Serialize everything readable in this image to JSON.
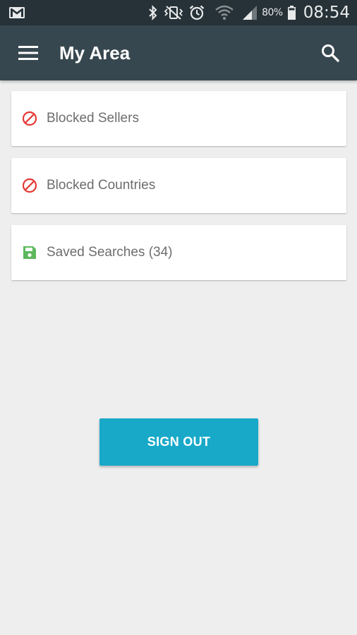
{
  "status_bar": {
    "icons": [
      "gmail-icon",
      "bluetooth-icon",
      "vibrate-icon",
      "alarm-icon",
      "wifi-icon",
      "signal-icon",
      "battery-icon"
    ],
    "battery": "80%",
    "time": "08:54"
  },
  "app_bar": {
    "title": "My Area",
    "menu_icon": "hamburger-menu-icon",
    "search_icon": "search-icon",
    "background": "#37474f"
  },
  "items": [
    {
      "label": "Blocked Sellers",
      "icon": "block-icon",
      "icon_color": "#e53935"
    },
    {
      "label": "Blocked Countries",
      "icon": "block-icon",
      "icon_color": "#e53935"
    },
    {
      "label": "Saved Searches (34)",
      "icon": "save-icon",
      "icon_color": "#5cb85c"
    }
  ],
  "sign_out": {
    "label": "SIGN OUT",
    "color": "#18a9c9"
  }
}
